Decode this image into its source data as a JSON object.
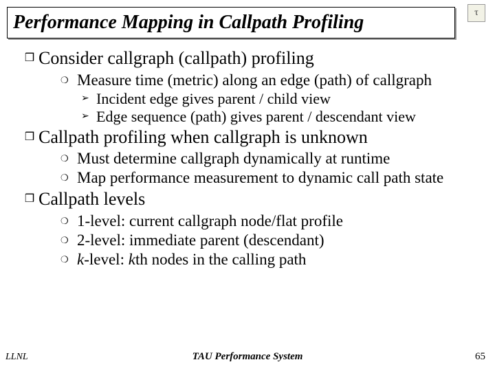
{
  "title": "Performance Mapping in Callpath Profiling",
  "logo_letter": "τ",
  "bullets": {
    "b1": "Consider callgraph (callpath) profiling",
    "b1_1": "Measure time (metric) along an edge (path) of callgraph",
    "b1_1_a": "Incident edge gives parent / child view",
    "b1_1_b": "Edge sequence (path) gives parent / descendant view",
    "b2": "Callpath profiling when callgraph is unknown",
    "b2_1": "Must determine callgraph dynamically at runtime",
    "b2_2": "Map performance measurement to dynamic call path state",
    "b3": "Callpath levels",
    "b3_1": "1-level: current callgraph node/flat profile",
    "b3_2": "2-level: immediate parent (descendant)",
    "b3_3_prefix": "k",
    "b3_3_mid": "-level: ",
    "b3_3_k2": "k",
    "b3_3_suffix": "th nodes in the calling path"
  },
  "footer": {
    "left": "LLNL",
    "center": "TAU Performance System",
    "right": "65"
  }
}
